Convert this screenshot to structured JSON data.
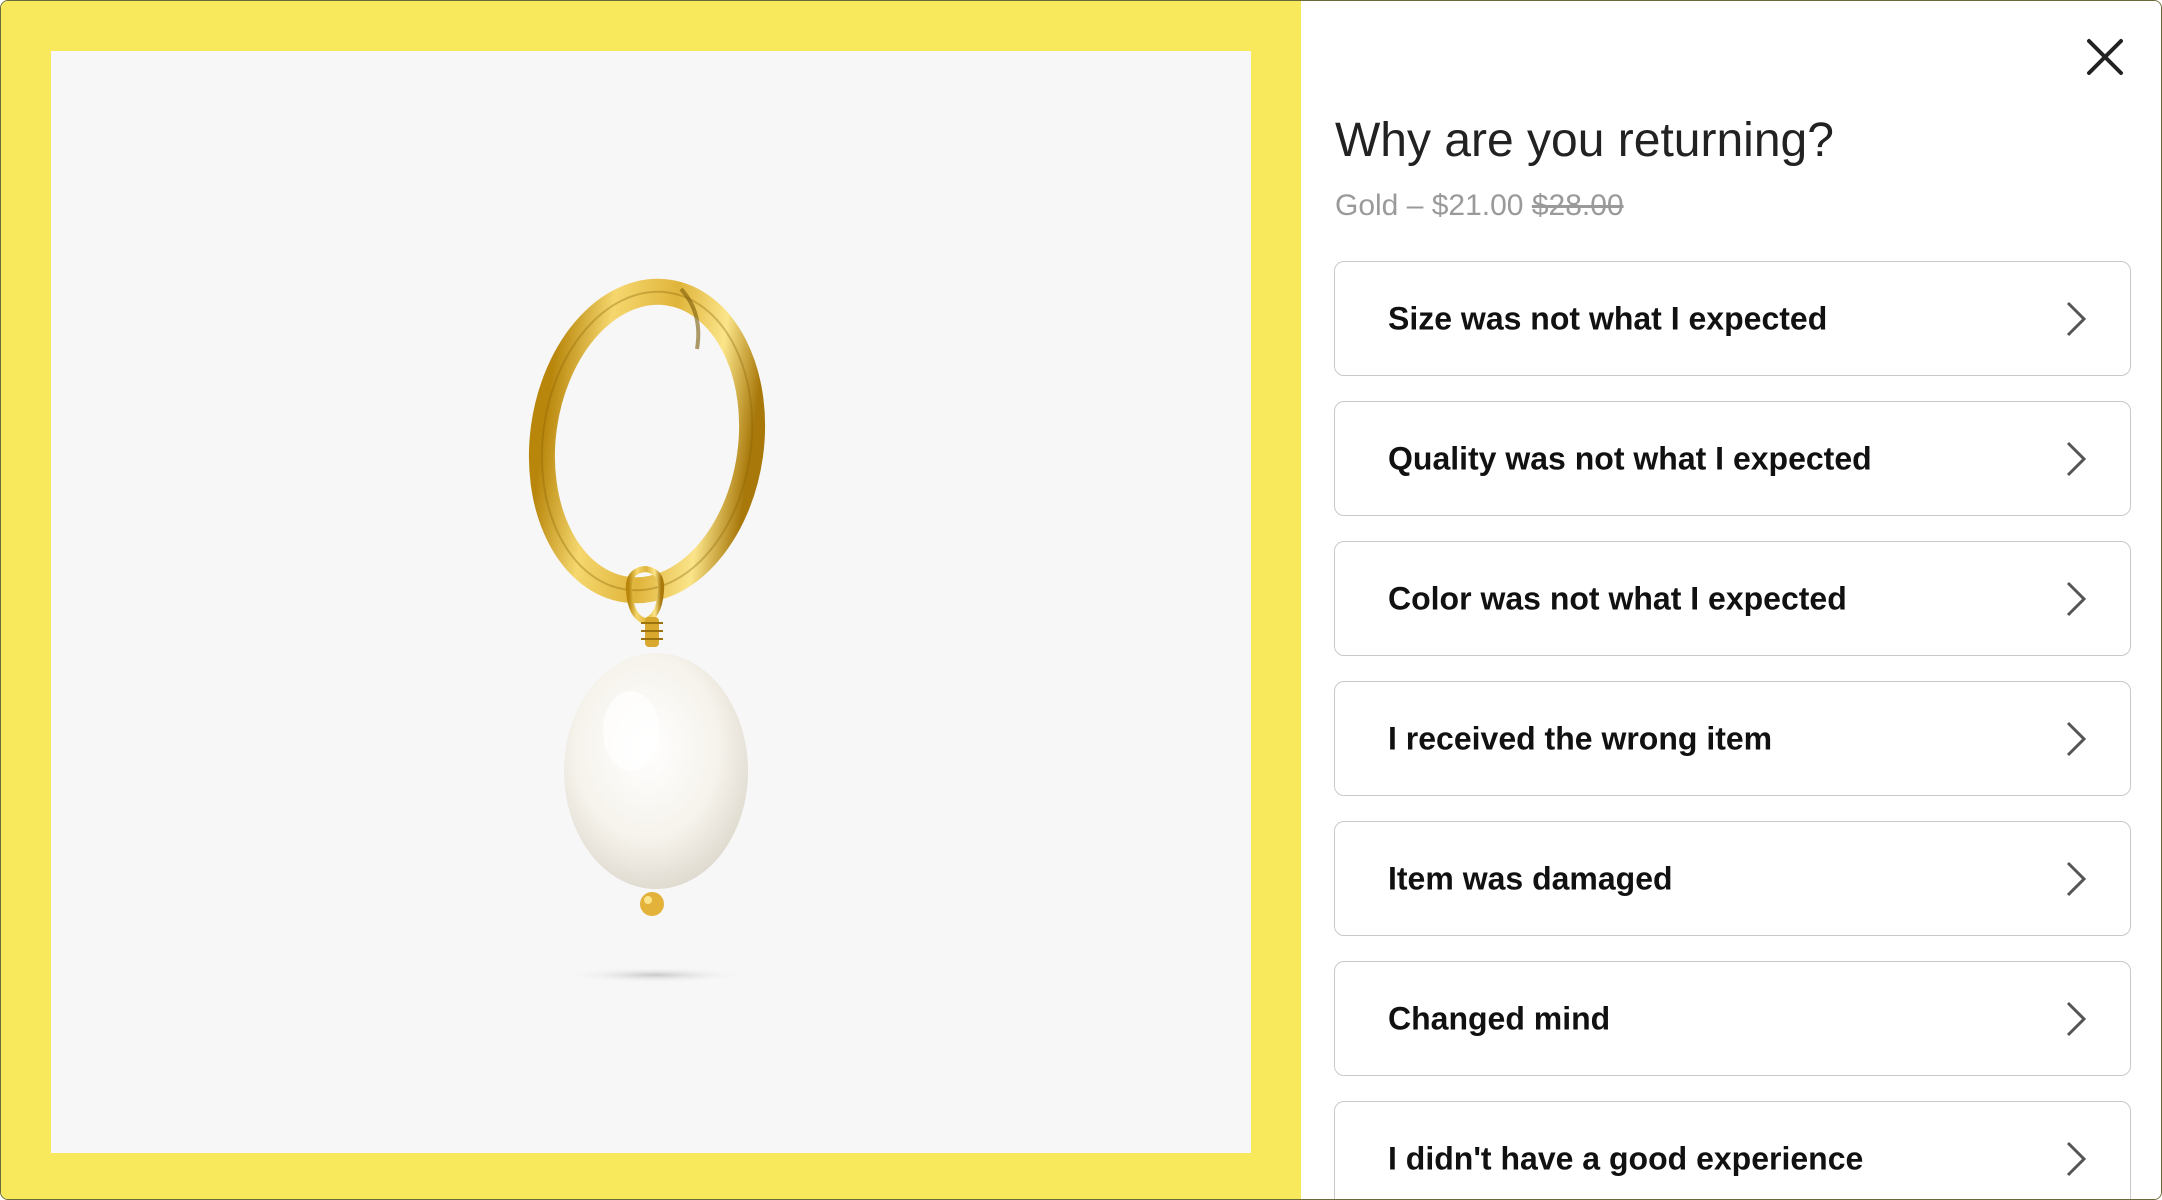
{
  "modal": {
    "title": "Why are you returning?",
    "variant_prefix": "Gold – ",
    "sale_price": "$21.00",
    "original_price": "$28.00",
    "close_icon": "close-icon",
    "chevron_icon": "chevron-right-icon"
  },
  "product_image": {
    "icon": "pearl-hoop-earring-image",
    "background_color": "#f7f7f7",
    "frame_color": "#f8e95c"
  },
  "reasons": [
    {
      "label": "Size was not what I expected"
    },
    {
      "label": "Quality was not what I expected"
    },
    {
      "label": "Color was not what I expected"
    },
    {
      "label": "I received the wrong item"
    },
    {
      "label": "Item was damaged"
    },
    {
      "label": "Changed mind"
    },
    {
      "label": "I didn't have a good experience"
    }
  ]
}
